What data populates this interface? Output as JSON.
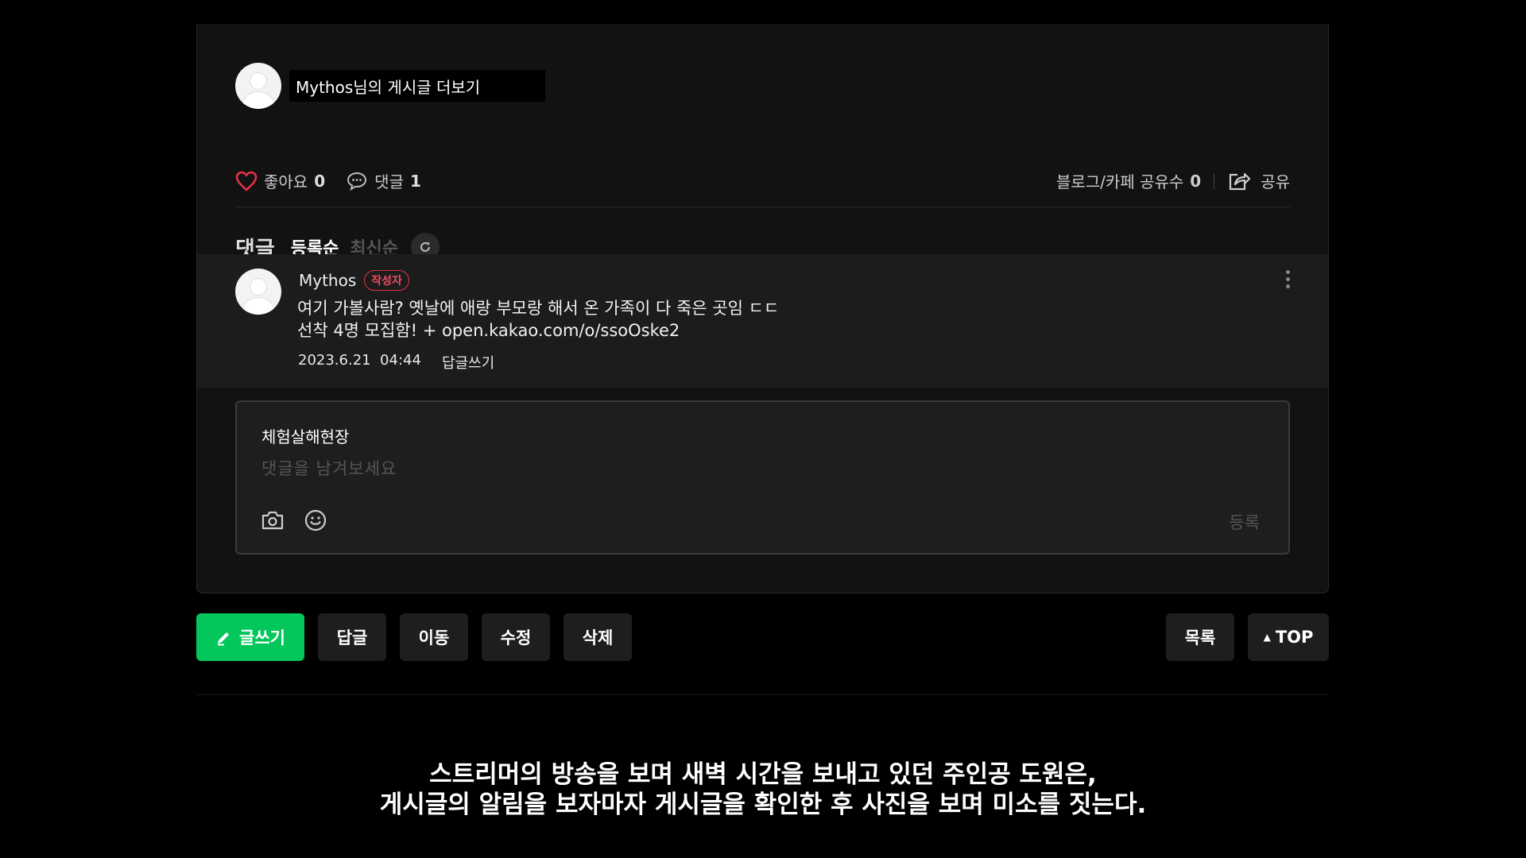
{
  "author": {
    "more_posts": "Mythos님의 게시글 더보기"
  },
  "stats": {
    "like_label": "좋아요",
    "like_count": "0",
    "comment_label": "댓글",
    "comment_count": "1",
    "share_count_label": "블로그/카페 공유수",
    "share_count": "0",
    "share_label": "공유"
  },
  "comments_header": {
    "title": "댓글",
    "sort_registered": "등록순",
    "sort_latest": "최신순"
  },
  "comment": {
    "author": "Mythos",
    "badge": "작성자",
    "line1": "여기 가볼사람? 옛날에 애랑 부모랑 해서 온 가족이 다 죽은 곳임 ㄷㄷ",
    "line2": "선착 4명 모집함! + open.kakao.com/o/ssoOske2",
    "date": "2023.6.21  04:44",
    "reply": "답글쓰기"
  },
  "editor": {
    "nickname": "체험살해현장",
    "placeholder": "댓글을 남겨보세요",
    "submit": "등록"
  },
  "buttons": {
    "write": "글쓰기",
    "reply": "답글",
    "move": "이동",
    "edit": "수정",
    "delete": "삭제",
    "list": "목록",
    "top": "TOP"
  },
  "subtitle": {
    "line1": "스트리머의 방송을 보며 새벽 시간을 보내고 있던 주인공 도원은,",
    "line2": "게시글의 알림을 보자마자 게시글을 확인한 후 사진을 보며 미소를 짓는다."
  },
  "colors": {
    "accent_green": "#03c75a",
    "like_red": "#e0334a",
    "badge_red": "#f04a60"
  }
}
